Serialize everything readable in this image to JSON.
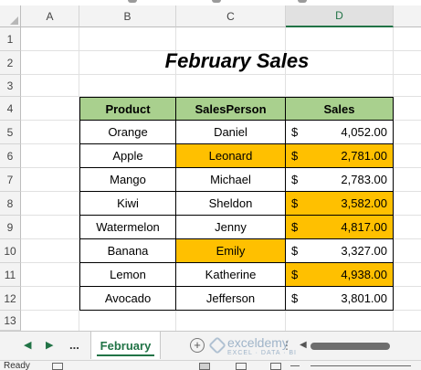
{
  "column_headers": [
    "A",
    "B",
    "C",
    "D"
  ],
  "row_numbers": [
    "1",
    "2",
    "3",
    "4",
    "5",
    "6",
    "7",
    "8",
    "9",
    "10",
    "11",
    "12",
    "13"
  ],
  "selected_column": "D",
  "sheet": {
    "title": "February Sales",
    "headers": {
      "product": "Product",
      "salesperson": "SalesPerson",
      "sales": "Sales"
    },
    "currency_symbol": "$",
    "rows": [
      {
        "product": "Orange",
        "salesperson": "Daniel",
        "sales": "4,052.00"
      },
      {
        "product": "Apple",
        "salesperson": "Leonard",
        "sales": "2,781.00"
      },
      {
        "product": "Mango",
        "salesperson": "Michael",
        "sales": "2,783.00"
      },
      {
        "product": "Kiwi",
        "salesperson": "Sheldon",
        "sales": "3,582.00"
      },
      {
        "product": "Watermelon",
        "salesperson": "Jenny",
        "sales": "4,817.00"
      },
      {
        "product": "Banana",
        "salesperson": "Emily",
        "sales": "3,327.00"
      },
      {
        "product": "Lemon",
        "salesperson": "Katherine",
        "sales": "4,938.00"
      },
      {
        "product": "Avocado",
        "salesperson": "Jefferson",
        "sales": "3,801.00"
      }
    ]
  },
  "tabs": {
    "ellipsis": "...",
    "active_sheet": "February",
    "add_sheet_symbol": "+"
  },
  "watermark": {
    "name": "exceldemy",
    "tagline": "EXCEL · DATA · BI"
  },
  "status": {
    "ready": "Ready"
  },
  "colors": {
    "header_fill": "#a9d08e",
    "highlight_fill": "#ffc000",
    "excel_green": "#217346"
  }
}
